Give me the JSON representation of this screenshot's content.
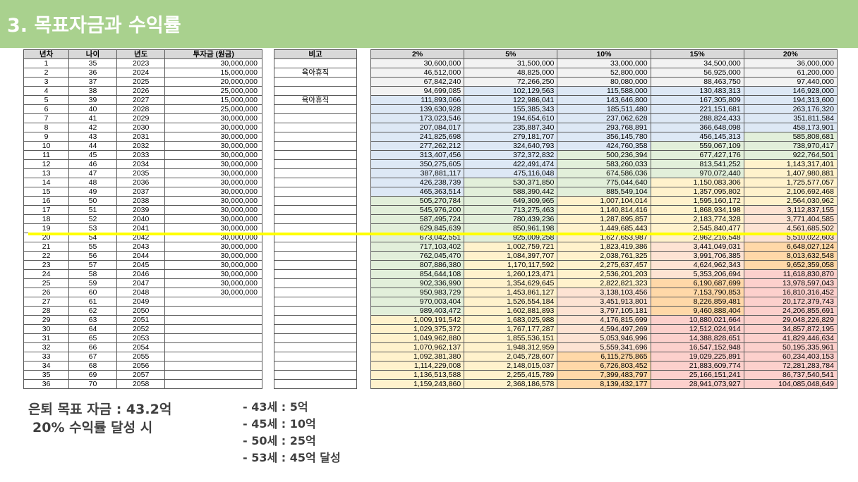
{
  "title": "3. 목표자금과 수익률",
  "headers": {
    "year_no": "년차",
    "age": "나이",
    "year": "년도",
    "investment": "투자금 (원금)",
    "note": "비고",
    "rates": [
      "2%",
      "5%",
      "10%",
      "15%",
      "20%"
    ]
  },
  "rows": [
    {
      "n": "1",
      "age": "35",
      "year": "2023",
      "inv": "30,000,000",
      "note": "",
      "v": [
        "30,600,000",
        "31,500,000",
        "33,000,000",
        "34,500,000",
        "36,000,000"
      ]
    },
    {
      "n": "2",
      "age": "36",
      "year": "2024",
      "inv": "15,000,000",
      "note": "육아휴직",
      "v": [
        "46,512,000",
        "48,825,000",
        "52,800,000",
        "56,925,000",
        "61,200,000"
      ]
    },
    {
      "n": "3",
      "age": "37",
      "year": "2025",
      "inv": "20,000,000",
      "note": "",
      "v": [
        "67,842,240",
        "72,266,250",
        "80,080,000",
        "88,463,750",
        "97,440,000"
      ]
    },
    {
      "n": "4",
      "age": "38",
      "year": "2026",
      "inv": "25,000,000",
      "note": "",
      "v": [
        "94,699,085",
        "102,129,563",
        "115,588,000",
        "130,483,313",
        "146,928,000"
      ]
    },
    {
      "n": "5",
      "age": "39",
      "year": "2027",
      "inv": "15,000,000",
      "note": "육아휴직",
      "v": [
        "111,893,066",
        "122,986,041",
        "143,646,800",
        "167,305,809",
        "194,313,600"
      ]
    },
    {
      "n": "6",
      "age": "40",
      "year": "2028",
      "inv": "25,000,000",
      "note": "",
      "v": [
        "139,630,928",
        "155,385,343",
        "185,511,480",
        "221,151,681",
        "263,176,320"
      ]
    },
    {
      "n": "7",
      "age": "41",
      "year": "2029",
      "inv": "30,000,000",
      "note": "",
      "v": [
        "173,023,546",
        "194,654,610",
        "237,062,628",
        "288,824,433",
        "351,811,584"
      ]
    },
    {
      "n": "8",
      "age": "42",
      "year": "2030",
      "inv": "30,000,000",
      "note": "",
      "v": [
        "207,084,017",
        "235,887,340",
        "293,768,891",
        "366,648,098",
        "458,173,901"
      ]
    },
    {
      "n": "9",
      "age": "43",
      "year": "2031",
      "inv": "30,000,000",
      "note": "",
      "v": [
        "241,825,698",
        "279,181,707",
        "356,145,780",
        "456,145,313",
        "585,808,681"
      ]
    },
    {
      "n": "10",
      "age": "44",
      "year": "2032",
      "inv": "30,000,000",
      "note": "",
      "v": [
        "277,262,212",
        "324,640,793",
        "424,760,358",
        "559,067,109",
        "738,970,417"
      ]
    },
    {
      "n": "11",
      "age": "45",
      "year": "2033",
      "inv": "30,000,000",
      "note": "",
      "v": [
        "313,407,456",
        "372,372,832",
        "500,236,394",
        "677,427,176",
        "922,764,501"
      ]
    },
    {
      "n": "12",
      "age": "46",
      "year": "2034",
      "inv": "30,000,000",
      "note": "",
      "v": [
        "350,275,605",
        "422,491,474",
        "583,260,033",
        "813,541,252",
        "1,143,317,401"
      ]
    },
    {
      "n": "13",
      "age": "47",
      "year": "2035",
      "inv": "30,000,000",
      "note": "",
      "v": [
        "387,881,117",
        "475,116,048",
        "674,586,036",
        "970,072,440",
        "1,407,980,881"
      ]
    },
    {
      "n": "14",
      "age": "48",
      "year": "2036",
      "inv": "30,000,000",
      "note": "",
      "v": [
        "426,238,739",
        "530,371,850",
        "775,044,640",
        "1,150,083,306",
        "1,725,577,057"
      ]
    },
    {
      "n": "15",
      "age": "49",
      "year": "2037",
      "inv": "30,000,000",
      "note": "",
      "v": [
        "465,363,514",
        "588,390,442",
        "885,549,104",
        "1,357,095,802",
        "2,106,692,468"
      ]
    },
    {
      "n": "16",
      "age": "50",
      "year": "2038",
      "inv": "30,000,000",
      "note": "",
      "v": [
        "505,270,784",
        "649,309,965",
        "1,007,104,014",
        "1,595,160,172",
        "2,564,030,962"
      ]
    },
    {
      "n": "17",
      "age": "51",
      "year": "2039",
      "inv": "30,000,000",
      "note": "",
      "v": [
        "545,976,200",
        "713,275,463",
        "1,140,814,416",
        "1,868,934,198",
        "3,112,837,155"
      ]
    },
    {
      "n": "18",
      "age": "52",
      "year": "2040",
      "inv": "30,000,000",
      "note": "",
      "v": [
        "587,495,724",
        "780,439,236",
        "1,287,895,857",
        "2,183,774,328",
        "3,771,404,585"
      ]
    },
    {
      "n": "19",
      "age": "53",
      "year": "2041",
      "inv": "30,000,000",
      "note": "",
      "v": [
        "629,845,639",
        "850,961,198",
        "1,449,685,443",
        "2,545,840,477",
        "4,561,685,502"
      ]
    },
    {
      "n": "20",
      "age": "54",
      "year": "2042",
      "inv": "30,000,000",
      "note": "",
      "v": [
        "673,042,551",
        "925,009,258",
        "1,627,653,987",
        "2,962,216,548",
        "5,510,022,603"
      ]
    },
    {
      "n": "21",
      "age": "55",
      "year": "2043",
      "inv": "30,000,000",
      "note": "",
      "v": [
        "717,103,402",
        "1,002,759,721",
        "1,823,419,386",
        "3,441,049,031",
        "6,648,027,124"
      ]
    },
    {
      "n": "22",
      "age": "56",
      "year": "2044",
      "inv": "30,000,000",
      "note": "",
      "v": [
        "762,045,470",
        "1,084,397,707",
        "2,038,761,325",
        "3,991,706,385",
        "8,013,632,548"
      ]
    },
    {
      "n": "23",
      "age": "57",
      "year": "2045",
      "inv": "30,000,000",
      "note": "",
      "v": [
        "807,886,380",
        "1,170,117,592",
        "2,275,637,457",
        "4,624,962,343",
        "9,652,359,058"
      ]
    },
    {
      "n": "24",
      "age": "58",
      "year": "2046",
      "inv": "30,000,000",
      "note": "",
      "v": [
        "854,644,108",
        "1,260,123,471",
        "2,536,201,203",
        "5,353,206,694",
        "11,618,830,870"
      ]
    },
    {
      "n": "25",
      "age": "59",
      "year": "2047",
      "inv": "30,000,000",
      "note": "",
      "v": [
        "902,336,990",
        "1,354,629,645",
        "2,822,821,323",
        "6,190,687,699",
        "13,978,597,043"
      ]
    },
    {
      "n": "26",
      "age": "60",
      "year": "2048",
      "inv": "30,000,000",
      "note": "",
      "v": [
        "950,983,729",
        "1,453,861,127",
        "3,138,103,456",
        "7,153,790,853",
        "16,810,316,452"
      ]
    },
    {
      "n": "27",
      "age": "61",
      "year": "2049",
      "inv": "",
      "note": "",
      "v": [
        "970,003,404",
        "1,526,554,184",
        "3,451,913,801",
        "8,226,859,481",
        "20,172,379,743"
      ]
    },
    {
      "n": "28",
      "age": "62",
      "year": "2050",
      "inv": "",
      "note": "",
      "v": [
        "989,403,472",
        "1,602,881,893",
        "3,797,105,181",
        "9,460,888,404",
        "24,206,855,691"
      ]
    },
    {
      "n": "29",
      "age": "63",
      "year": "2051",
      "inv": "",
      "note": "",
      "v": [
        "1,009,191,542",
        "1,683,025,988",
        "4,176,815,699",
        "10,880,021,664",
        "29,048,226,829"
      ]
    },
    {
      "n": "30",
      "age": "64",
      "year": "2052",
      "inv": "",
      "note": "",
      "v": [
        "1,029,375,372",
        "1,767,177,287",
        "4,594,497,269",
        "12,512,024,914",
        "34,857,872,195"
      ]
    },
    {
      "n": "31",
      "age": "65",
      "year": "2053",
      "inv": "",
      "note": "",
      "v": [
        "1,049,962,880",
        "1,855,536,151",
        "5,053,946,996",
        "14,388,828,651",
        "41,829,446,634"
      ]
    },
    {
      "n": "32",
      "age": "66",
      "year": "2054",
      "inv": "",
      "note": "",
      "v": [
        "1,070,962,137",
        "1,948,312,959",
        "5,559,341,696",
        "16,547,152,948",
        "50,195,335,961"
      ]
    },
    {
      "n": "33",
      "age": "67",
      "year": "2055",
      "inv": "",
      "note": "",
      "v": [
        "1,092,381,380",
        "2,045,728,607",
        "6,115,275,865",
        "19,029,225,891",
        "60,234,403,153"
      ]
    },
    {
      "n": "34",
      "age": "68",
      "year": "2056",
      "inv": "",
      "note": "",
      "v": [
        "1,114,229,008",
        "2,148,015,037",
        "6,726,803,452",
        "21,883,609,774",
        "72,281,283,784"
      ]
    },
    {
      "n": "35",
      "age": "69",
      "year": "2057",
      "inv": "",
      "note": "",
      "v": [
        "1,136,513,588",
        "2,255,415,789",
        "7,399,483,797",
        "25,166,151,241",
        "86,737,540,541"
      ]
    },
    {
      "n": "36",
      "age": "70",
      "year": "2058",
      "inv": "",
      "note": "",
      "v": [
        "1,159,243,860",
        "2,368,186,578",
        "8,139,432,177",
        "28,941,073,927",
        "104,085,048,649"
      ]
    }
  ],
  "color_scale": {
    "low": "#f2f2f2",
    "band1": "#dde8f5",
    "band2": "#e2efda",
    "band3": "#fff2cc",
    "band4": "#fde3d3",
    "band5": "#ffd8a8",
    "band6": "#fcd0cc"
  },
  "highlight_color": "#ffff00",
  "summary": {
    "line1": "은퇴 목표 자금 : 43.2억",
    "line2": "20% 수익률 달성 시"
  },
  "milestones": [
    "- 43세 : 5억",
    "- 45세 : 10억",
    "- 50세 : 25억",
    "- 53세 : 45억 달성"
  ]
}
